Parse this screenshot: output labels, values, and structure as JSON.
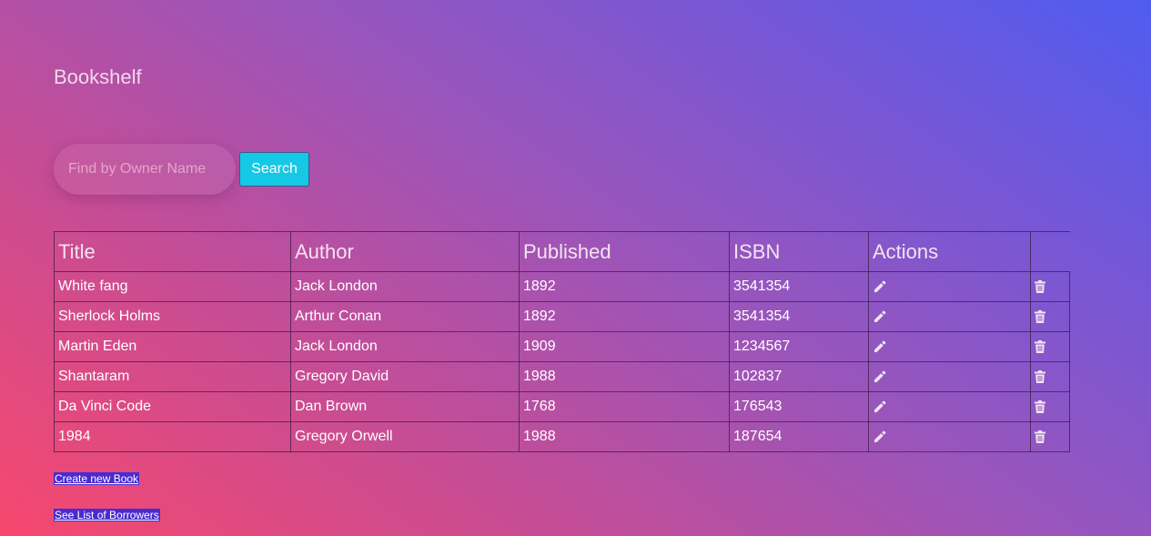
{
  "page": {
    "title": "Bookshelf"
  },
  "search": {
    "placeholder": "Find by Owner Name",
    "value": "",
    "button_label": "Search"
  },
  "table": {
    "headers": [
      "Title",
      "Author",
      "Published",
      "ISBN",
      "Actions",
      ""
    ],
    "rows": [
      {
        "title": "White fang",
        "author": "Jack London",
        "published": "1892",
        "isbn": "3541354"
      },
      {
        "title": "Sherlock Holms",
        "author": "Arthur Conan",
        "published": "1892",
        "isbn": "3541354"
      },
      {
        "title": "Martin Eden",
        "author": "Jack London",
        "published": "1909",
        "isbn": "1234567"
      },
      {
        "title": "Shantaram",
        "author": "Gregory David",
        "published": "1988",
        "isbn": "102837"
      },
      {
        "title": "Da Vinci Code",
        "author": "Dan Brown",
        "published": "1768",
        "isbn": "176543"
      },
      {
        "title": "1984",
        "author": "Gregory Orwell",
        "published": "1988",
        "isbn": "187654"
      }
    ],
    "row_actions": {
      "edit_icon": "pencil-icon",
      "delete_icon": "trash-icon"
    }
  },
  "links": {
    "create_book": "Create new Book",
    "see_borrowers": "See List of Borrowers"
  },
  "colors": {
    "search_button": "#14c8e6",
    "link_background": "#4a2bd0"
  }
}
